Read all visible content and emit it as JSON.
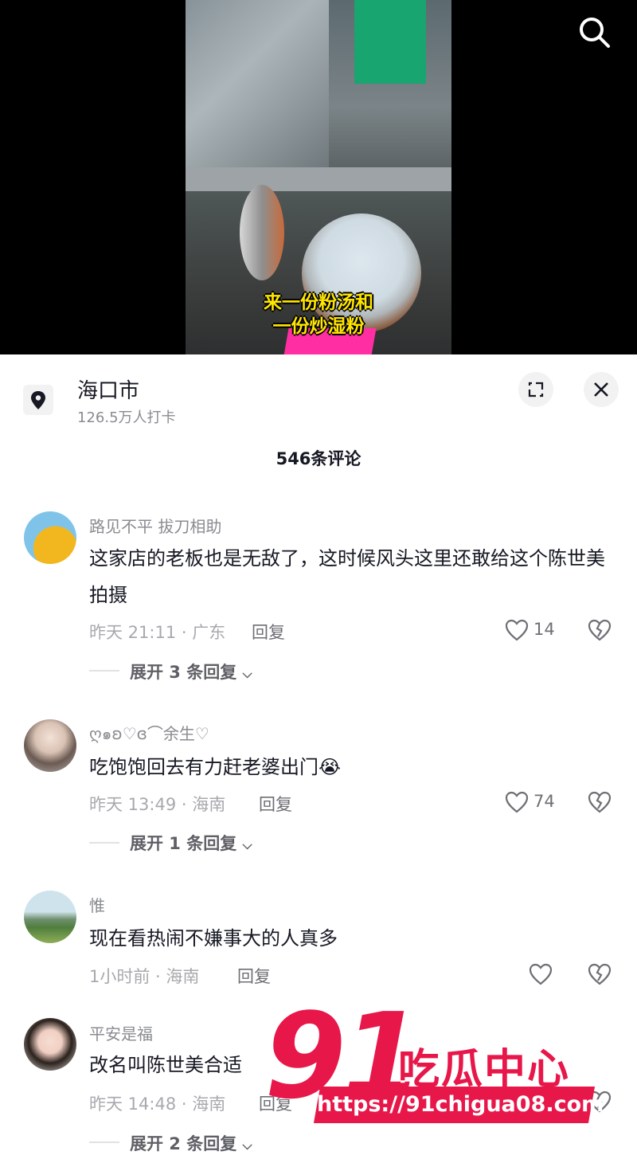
{
  "video": {
    "caption_line1": "来一份粉汤和",
    "caption_line2": "一份炒湿粉"
  },
  "location": {
    "title": "海口市",
    "checkins": "126.5万人打卡"
  },
  "comments_header": {
    "count_label": "546条评论"
  },
  "comments": [
    {
      "name": "路见不平 拔刀相助",
      "text": "这家店的老板也是无敌了，这时候风头这里还敢给这个陈世美拍摄",
      "time_location": "昨天 21:11 · 广东",
      "reply_label": "回复",
      "likes": "14",
      "expand_label": "展开 3 条回复"
    },
    {
      "name": "ღ๑ʚ♡ɞ⌒余生♡",
      "text": "吃饱饱回去有力赶老婆出门😭",
      "time_location": "昨天 13:49 · 海南",
      "reply_label": "回复",
      "likes": "74",
      "expand_label": "展开 1 条回复"
    },
    {
      "name": "惟",
      "text": "现在看热闹不嫌事大的人真多",
      "time_location": "1小时前 · 海南",
      "reply_label": "回复",
      "likes": ""
    },
    {
      "name": "平安是福",
      "text": "改名叫陈世美合适",
      "time_location": "昨天 14:48 · 海南",
      "reply_label": "回复",
      "likes": "",
      "expand_label": "展开 2 条回复"
    }
  ],
  "watermark": {
    "number": "91",
    "name": "吃瓜中心",
    "url": "https://91chigua08.com"
  },
  "colors": {
    "caption": "#ffe600",
    "watermark": "#e8174a",
    "text_primary": "#161823",
    "text_secondary": "#8a8b91"
  }
}
